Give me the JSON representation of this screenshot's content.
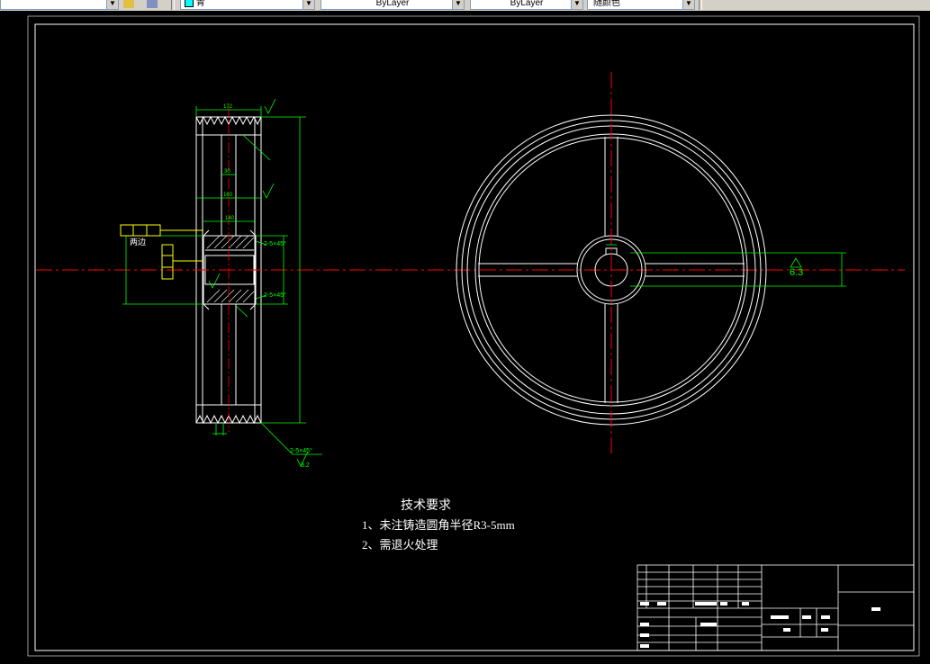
{
  "toolbar": {
    "layer_value": "青",
    "color_value": "ByLayer",
    "linetype_value": "ByLayer",
    "lineweight_value": "随颜色"
  },
  "drawing": {
    "tech_title": "技术要求",
    "tech_line1": "1、未注铸造圆角半径R3-5mm",
    "tech_line2": "2、需退火处理",
    "roughness_main": "6.3",
    "chamfer_1": "2-5×45°",
    "chamfer_2": "2-5×45°",
    "chamfer_3": "2-5×45°",
    "side_note": "两边",
    "roughness_small": "3.2",
    "dim_top": "172",
    "dim_web": "160",
    "dim_hub": "140",
    "dim_inner": "30"
  },
  "colors": {
    "background": "#000000",
    "lines": "#ffffff",
    "dimension": "#00ff00",
    "center": "#ff0000",
    "note": "#ffff00"
  }
}
